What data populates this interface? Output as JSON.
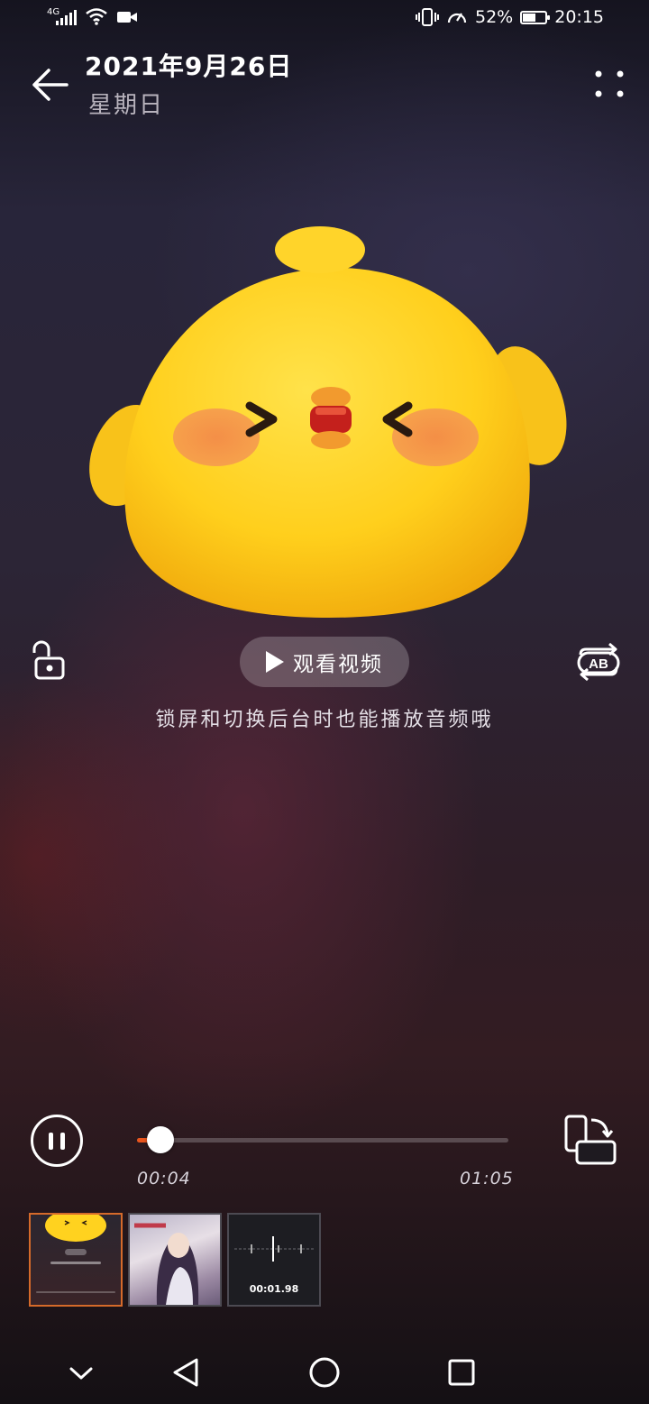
{
  "status_bar": {
    "network_label": "4G",
    "battery_percent": "52%",
    "battery_level": 0.52,
    "time": "20:15"
  },
  "header": {
    "date": "2021年9月26日",
    "weekday": "星期日"
  },
  "player": {
    "watch_video_label": "观看视频",
    "hint_text": "锁屏和切换后台时也能播放音频哦",
    "ab_label": "AB",
    "elapsed": "00:04",
    "duration": "01:05",
    "progress": 0.062,
    "is_playing": true
  },
  "thumbnails": [
    {
      "kind": "audio-cover",
      "active": true
    },
    {
      "kind": "anime-image",
      "active": false
    },
    {
      "kind": "recording",
      "caption": "00:01.98",
      "active": false
    }
  ],
  "colors": {
    "accent": "#e9551d",
    "mascot_yellow": "#ffd21f",
    "cheek": "#f08a4b"
  }
}
